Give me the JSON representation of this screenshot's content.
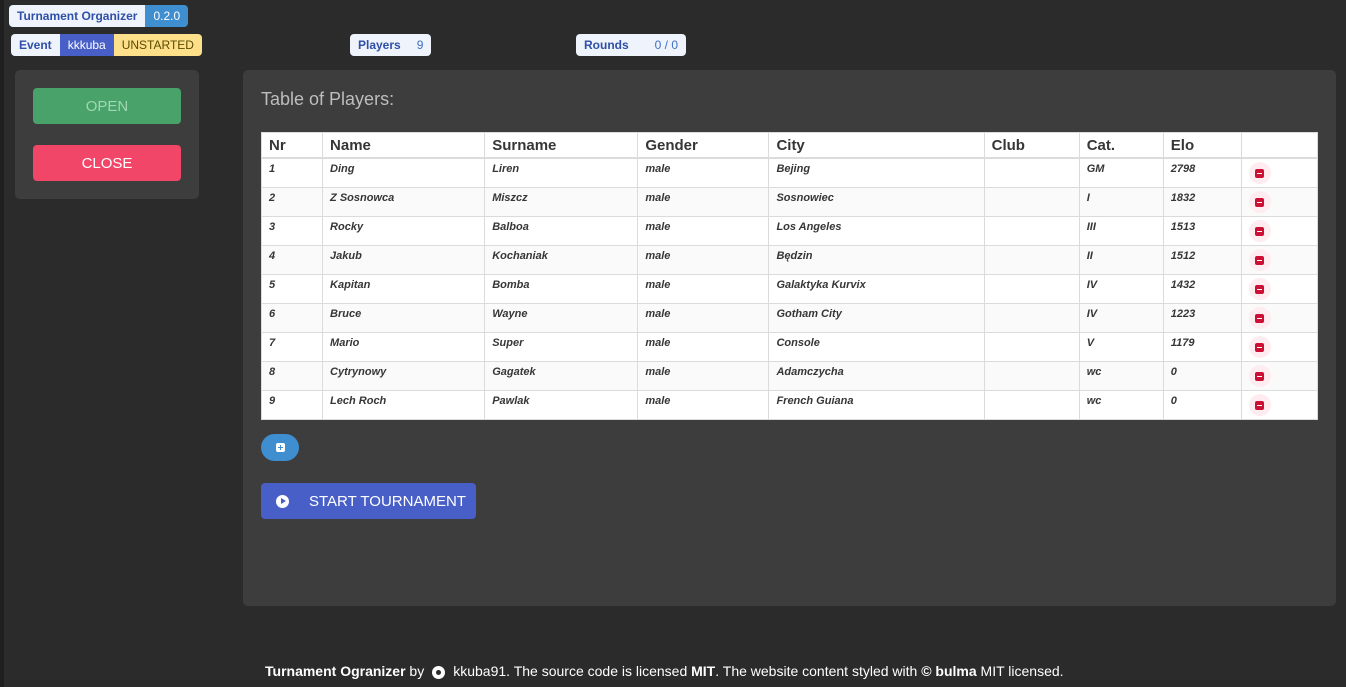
{
  "app": {
    "name": "Turnament Organizer",
    "version": "0.2.0"
  },
  "event": {
    "label": "Event",
    "owner": "kkkuba",
    "status": "UNSTARTED"
  },
  "players_tag": {
    "label": "Players",
    "count": "9"
  },
  "rounds_tag": {
    "label": "Rounds",
    "value": "0 / 0"
  },
  "sidebar": {
    "open_label": "OPEN",
    "close_label": "CLOSE"
  },
  "main": {
    "title": "Table of Players:",
    "columns": [
      "Nr",
      "Name",
      "Surname",
      "Gender",
      "City",
      "Club",
      "Cat.",
      "Elo",
      ""
    ],
    "rows": [
      [
        "1",
        "Ding",
        "Liren",
        "male",
        "Bejing",
        "",
        "GM",
        "2798"
      ],
      [
        "2",
        "Z Sosnowca",
        "Miszcz",
        "male",
        "Sosnowiec",
        "",
        "I",
        "1832"
      ],
      [
        "3",
        "Rocky",
        "Balboa",
        "male",
        "Los Angeles",
        "",
        "III",
        "1513"
      ],
      [
        "4",
        "Jakub",
        "Kochaniak",
        "male",
        "Będzin",
        "",
        "II",
        "1512"
      ],
      [
        "5",
        "Kapitan",
        "Bomba",
        "male",
        "Galaktyka Kurvix",
        "",
        "IV",
        "1432"
      ],
      [
        "6",
        "Bruce",
        "Wayne",
        "male",
        "Gotham City",
        "",
        "IV",
        "1223"
      ],
      [
        "7",
        "Mario",
        "Super",
        "male",
        "Console",
        "",
        "V",
        "1179"
      ],
      [
        "8",
        "Cytrynowy",
        "Gagatek",
        "male",
        "Adamczycha",
        "",
        "wc",
        "0"
      ],
      [
        "9",
        "Lech Roch",
        "Pawlak",
        "male",
        "French Guiana",
        "",
        "wc",
        "0"
      ]
    ],
    "start_label": "START TOURNAMENT"
  },
  "footer": {
    "project": "Turnament Ogranizer",
    "by": " by",
    "author": "kkuba91",
    "text1": ". The source code is licensed ",
    "license": "MIT",
    "text2": ". The website content styled with ",
    "copy": "©",
    "styled": "bulma",
    "text3": " MIT licensed."
  },
  "colors": {
    "open": "#48a26a",
    "close": "#f14668",
    "start": "#485fc7",
    "add": "#3e8ed0",
    "status_tag": "#ffe08a"
  },
  "icons": {
    "delete": "minus-circle-icon",
    "add": "plus-square-icon",
    "start": "play-circle-icon",
    "footer": "github-icon"
  }
}
